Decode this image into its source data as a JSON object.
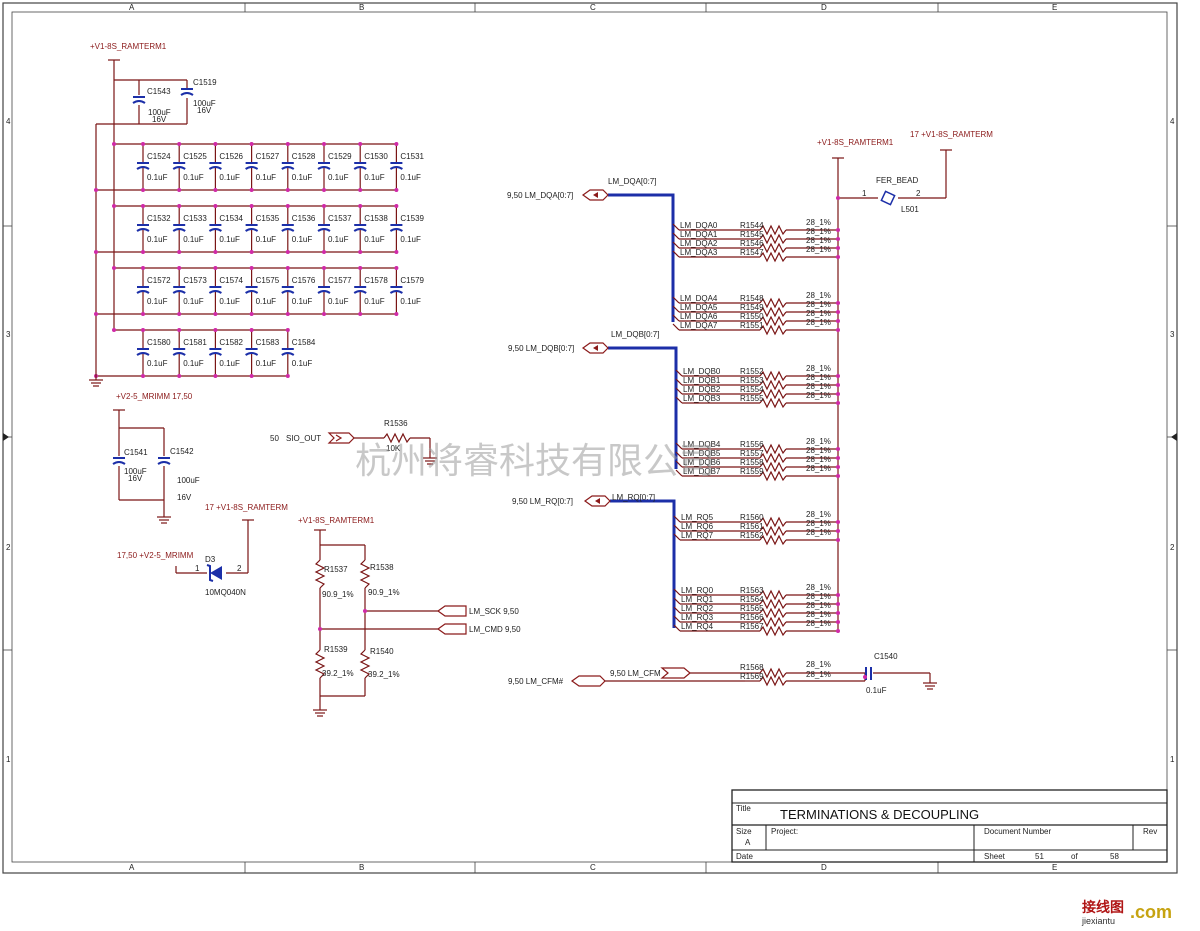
{
  "columns": [
    "A",
    "B",
    "C",
    "D",
    "E"
  ],
  "rows": [
    "4",
    "3",
    "2",
    "1"
  ],
  "title_block": {
    "title_label": "Title",
    "title": "TERMINATIONS & DECOUPLING",
    "size_label": "Size",
    "size": "A",
    "project_label": "Project:",
    "docnum_label": "Document Number",
    "rev_label": "Rev",
    "date_label": "Date",
    "sheet_label": "Sheet",
    "sheet_num": "51",
    "of_label": "of",
    "sheet_total": "58"
  },
  "watermark": "杭州将睿科技有限公司",
  "site_logo": {
    "cn": "接线图",
    "domain": "jiexiantu",
    "com": ".com"
  },
  "decoupling": {
    "rail": "+V1-8S_RAMTERM1",
    "bulk": [
      {
        "ref": "C1543",
        "value": "100uF",
        "voltage": "16V"
      },
      {
        "ref": "C1519",
        "value": "100uF",
        "voltage": "16V"
      }
    ],
    "rows": [
      {
        "refs": [
          "C1524",
          "C1525",
          "C1526",
          "C1527",
          "C1528",
          "C1529",
          "C1530",
          "C1531"
        ]
      },
      {
        "refs": [
          "C1532",
          "C1533",
          "C1534",
          "C1535",
          "C1536",
          "C1537",
          "C1538",
          "C1539"
        ]
      },
      {
        "refs": [
          "C1572",
          "C1573",
          "C1574",
          "C1575",
          "C1576",
          "C1577",
          "C1578",
          "C1579"
        ]
      },
      {
        "refs": [
          "C1580",
          "C1581",
          "C1582",
          "C1583",
          "C1584"
        ]
      }
    ],
    "cap_value": "0.1uF"
  },
  "mrimm": {
    "rail": "+V2-5_MRIMM 17,50",
    "c1": {
      "ref": "C1541",
      "value": "100uF",
      "voltage": "16V"
    },
    "c2": {
      "ref": "C1542",
      "value": "100uF",
      "voltage": "16V"
    }
  },
  "sio": {
    "page": "50",
    "net": "SIO_OUT",
    "ref": "R1536",
    "value": "10K"
  },
  "diode": {
    "rail_top": "17  +V1-8S_RAMTERM",
    "rail_left": "17,50  +V2-5_MRIMM",
    "ref": "D3",
    "part": "10MQ040N",
    "pin1": "1",
    "pin2": "2"
  },
  "divider": {
    "rail": "+V1-8S_RAMTERM1",
    "r_top": [
      {
        "ref": "R1537",
        "value": "90.9_1%"
      },
      {
        "ref": "R1538",
        "value": "90.9_1%"
      }
    ],
    "r_bot": [
      {
        "ref": "R1539",
        "value": "39.2_1%"
      },
      {
        "ref": "R1540",
        "value": "39.2_1%"
      }
    ],
    "net_sck": "LM_SCK  9,50",
    "net_cmd": "LM_CMD  9,50"
  },
  "ferrite": {
    "rail_left": "+V1-8S_RAMTERM1",
    "rail_right": "17  +V1-8S_RAMTERM",
    "name": "FER_BEAD",
    "ref": "L501",
    "pin1": "1",
    "pin2": "2"
  },
  "buses": [
    {
      "port": "9,50  LM_DQA[0:7]",
      "label": "LM_DQA[0:7]"
    },
    {
      "port": "9,50  LM_DQB[0:7]",
      "label": "LM_DQB[0:7]"
    },
    {
      "port": "9,50  LM_RQ[0:7]",
      "label": "LM_RQ[0:7]"
    }
  ],
  "term_value": "28_1%",
  "terminations": [
    {
      "net": "LM_DQA0",
      "ref": "R1544"
    },
    {
      "net": "LM_DQA1",
      "ref": "R1545"
    },
    {
      "net": "LM_DQA2",
      "ref": "R1546"
    },
    {
      "net": "LM_DQA3",
      "ref": "R1547"
    },
    {
      "net": "LM_DQA4",
      "ref": "R1548"
    },
    {
      "net": "LM_DQA5",
      "ref": "R1549"
    },
    {
      "net": "LM_DQA6",
      "ref": "R1550"
    },
    {
      "net": "LM_DQA7",
      "ref": "R1551"
    },
    {
      "net": "LM_DQB0",
      "ref": "R1552"
    },
    {
      "net": "LM_DQB1",
      "ref": "R1553"
    },
    {
      "net": "LM_DQB2",
      "ref": "R1554"
    },
    {
      "net": "LM_DQB3",
      "ref": "R1555"
    },
    {
      "net": "LM_DQB4",
      "ref": "R1556"
    },
    {
      "net": "LM_DQB5",
      "ref": "R1557"
    },
    {
      "net": "LM_DQB6",
      "ref": "R1558"
    },
    {
      "net": "LM_DQB7",
      "ref": "R1559"
    },
    {
      "net": "LM_RQ5",
      "ref": "R1560"
    },
    {
      "net": "LM_RQ6",
      "ref": "R1561"
    },
    {
      "net": "LM_RQ7",
      "ref": "R1562"
    },
    {
      "net": "LM_RQ0",
      "ref": "R1563"
    },
    {
      "net": "LM_RQ1",
      "ref": "R1564"
    },
    {
      "net": "LM_RQ2",
      "ref": "R1565"
    },
    {
      "net": "LM_RQ3",
      "ref": "R1566"
    },
    {
      "net": "LM_RQ4",
      "ref": "R1567"
    }
  ],
  "cfm": {
    "port": "9,50  LM_CFM#",
    "net": "9,50  LM_CFM",
    "r1": "R1568",
    "r2": "R1569",
    "cap_ref": "C1540",
    "cap_value": "0.1uF"
  }
}
